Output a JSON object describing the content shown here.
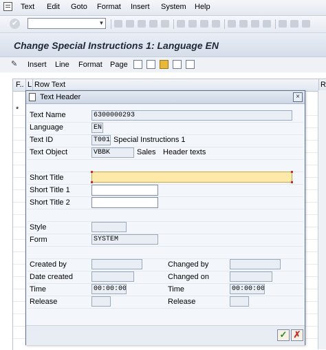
{
  "menu": {
    "items": [
      {
        "name": "menu-text",
        "label": "Text"
      },
      {
        "name": "menu-edit",
        "label": "Edit"
      },
      {
        "name": "menu-goto",
        "label": "Goto"
      },
      {
        "name": "menu-format",
        "label": "Format"
      },
      {
        "name": "menu-insert",
        "label": "Insert"
      },
      {
        "name": "menu-system",
        "label": "System"
      },
      {
        "name": "menu-help",
        "label": "Help"
      }
    ]
  },
  "command_field": {
    "value": ""
  },
  "screen": {
    "title": "Change Special Instructions 1: Language EN"
  },
  "app_toolbar": {
    "insert": "Insert",
    "line": "Line",
    "format": "Format",
    "page": "Page"
  },
  "editor": {
    "col_f": "F..",
    "col_l": "L",
    "col_row_text": "Row Text",
    "col_r": "R",
    "marker": "*"
  },
  "dialog": {
    "title": "Text Header",
    "text_name": {
      "label": "Text Name",
      "value": "6300000293"
    },
    "language": {
      "label": "Language",
      "value": "EN"
    },
    "text_id": {
      "label": "Text ID",
      "value": "T001",
      "desc": "Special Instructions 1"
    },
    "text_object": {
      "label": "Text Object",
      "value": "VBBK",
      "desc1": "Sales",
      "desc2": "Header texts"
    },
    "short_title": {
      "label": "Short Title",
      "value": ""
    },
    "short_title_1": {
      "label": "Short Title 1",
      "value": ""
    },
    "short_title_2": {
      "label": "Short Title 2",
      "value": ""
    },
    "style": {
      "label": "Style",
      "value": ""
    },
    "form": {
      "label": "Form",
      "value": "SYSTEM"
    },
    "created_by": {
      "label": "Created by",
      "value": ""
    },
    "date_created": {
      "label": "Date created",
      "value": ""
    },
    "time_left": {
      "label": "Time",
      "value": "00:00:00"
    },
    "release_left": {
      "label": "Release",
      "value": ""
    },
    "changed_by": {
      "label": "Changed by",
      "value": ""
    },
    "changed_on": {
      "label": "Changed on",
      "value": ""
    },
    "time_right": {
      "label": "Time",
      "value": "00:00:00"
    },
    "release_right": {
      "label": "Release",
      "value": ""
    }
  },
  "icons": {
    "close": "×",
    "confirm": "✓",
    "cancel": "✗",
    "dropdown": "▼",
    "enter": "✔"
  }
}
